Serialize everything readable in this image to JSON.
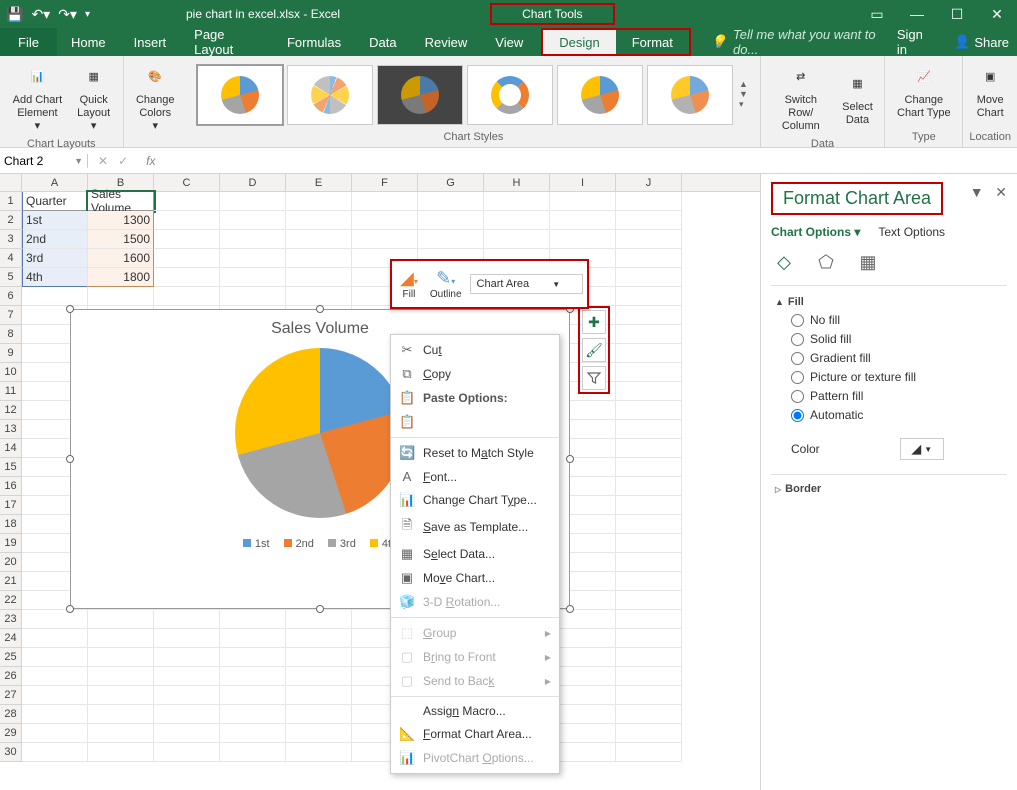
{
  "title": "pie chart in excel.xlsx - Excel",
  "chart_tools_label": "Chart Tools",
  "tabs": {
    "file": "File",
    "home": "Home",
    "insert": "Insert",
    "page_layout": "Page Layout",
    "formulas": "Formulas",
    "data": "Data",
    "review": "Review",
    "view": "View",
    "design": "Design",
    "format": "Format"
  },
  "tellme": "Tell me what you want to do...",
  "signin": "Sign in",
  "share": "Share",
  "ribbon": {
    "add_element": "Add Chart Element",
    "quick_layout": "Quick Layout",
    "change_colors": "Change Colors",
    "chart_layouts": "Chart Layouts",
    "chart_styles": "Chart Styles",
    "switch": "Switch Row/ Column",
    "select_data": "Select Data",
    "data": "Data",
    "change_type": "Change Chart Type",
    "type": "Type",
    "move_chart": "Move Chart",
    "location": "Location"
  },
  "namebox": "Chart 2",
  "columns": [
    "A",
    "B",
    "C",
    "D",
    "E",
    "F",
    "G",
    "H",
    "I",
    "J"
  ],
  "table": {
    "headers": [
      "Quarter",
      "Sales Volume"
    ],
    "rows": [
      [
        "1st",
        1300
      ],
      [
        "2nd",
        1500
      ],
      [
        "3rd",
        1600
      ],
      [
        "4th",
        1800
      ]
    ]
  },
  "chart_data": {
    "type": "pie",
    "title": "Sales Volume",
    "categories": [
      "1st",
      "2nd",
      "3rd",
      "4th"
    ],
    "values": [
      1300,
      1500,
      1600,
      1800
    ],
    "colors": [
      "#5b9bd5",
      "#ed7d31",
      "#a5a5a5",
      "#ffc000"
    ]
  },
  "minitool": {
    "fill": "Fill",
    "outline": "Outline",
    "sel": "Chart Area"
  },
  "ctx": {
    "cut": "Cut",
    "copy": "Copy",
    "paste_opt": "Paste Options:",
    "reset": "Reset to Match Style",
    "font": "Font...",
    "change_type": "Change Chart Type...",
    "save_tmpl": "Save as Template...",
    "select_data": "Select Data...",
    "move": "Move Chart...",
    "rot3d": "3-D Rotation...",
    "group": "Group",
    "front": "Bring to Front",
    "back": "Send to Back",
    "macro": "Assign Macro...",
    "fmt": "Format Chart Area...",
    "pivot": "PivotChart Options..."
  },
  "fpane": {
    "title": "Format Chart Area",
    "chart_options": "Chart Options",
    "text_options": "Text Options",
    "fill": "Fill",
    "no_fill": "No fill",
    "solid": "Solid fill",
    "gradient": "Gradient fill",
    "picture": "Picture or texture fill",
    "pattern": "Pattern fill",
    "auto": "Automatic",
    "color": "Color",
    "border": "Border"
  }
}
